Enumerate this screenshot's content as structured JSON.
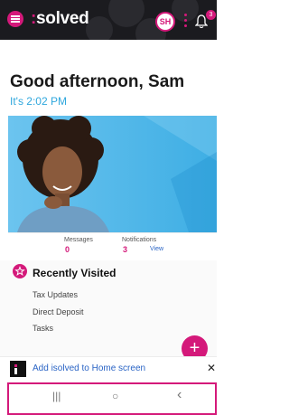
{
  "header": {
    "logo_mark": ":",
    "logo_text": "solved",
    "avatar_initials": "SH",
    "notification_badge": "3"
  },
  "greeting": {
    "title": "Good afternoon, Sam",
    "time": "It's 2:02 PM"
  },
  "stats": {
    "messages_label": "Messages",
    "messages_count": "0",
    "notifications_label": "Notifications",
    "notifications_count": "3",
    "view_label": "View"
  },
  "recently_visited": {
    "title": "Recently Visited",
    "items": [
      "Tax Updates",
      "Direct Deposit",
      "Tasks"
    ]
  },
  "fab": {
    "label": "+"
  },
  "add_to_home": {
    "text": "Add isolved to Home screen",
    "close": "✕"
  },
  "system_nav": {
    "recents": "|||",
    "home": "○",
    "back": "‹"
  },
  "colors": {
    "accent": "#d4197a",
    "link": "#2a64c5",
    "time": "#2fa7dd",
    "topbar": "#1b1b1f"
  }
}
